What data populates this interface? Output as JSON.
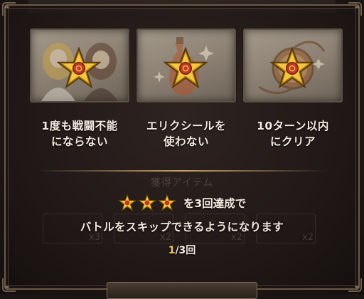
{
  "missions": [
    {
      "label": "1度も戦闘不能\nにならない",
      "icon": "party-portrait-icon"
    },
    {
      "label": "エリクシールを\n使わない",
      "icon": "elixir-bottle-icon"
    },
    {
      "label": "10ターン以内\nにクリア",
      "icon": "pocket-watch-icon"
    }
  ],
  "faded_header": "獲得アイテム",
  "skip": {
    "line1": "を3回達成で",
    "line2": "バトルをスキップできるようになります",
    "progress_current": "1",
    "progress_rest": "/3回",
    "star_count": 3
  },
  "ghost_items": [
    {
      "count": "x3"
    },
    {
      "count": "x2"
    },
    {
      "count": "x2"
    },
    {
      "count": "x2"
    }
  ],
  "colors": {
    "accent_gold": "#f0c766",
    "text": "#f2ebe1",
    "frame": "#6b5a48"
  }
}
